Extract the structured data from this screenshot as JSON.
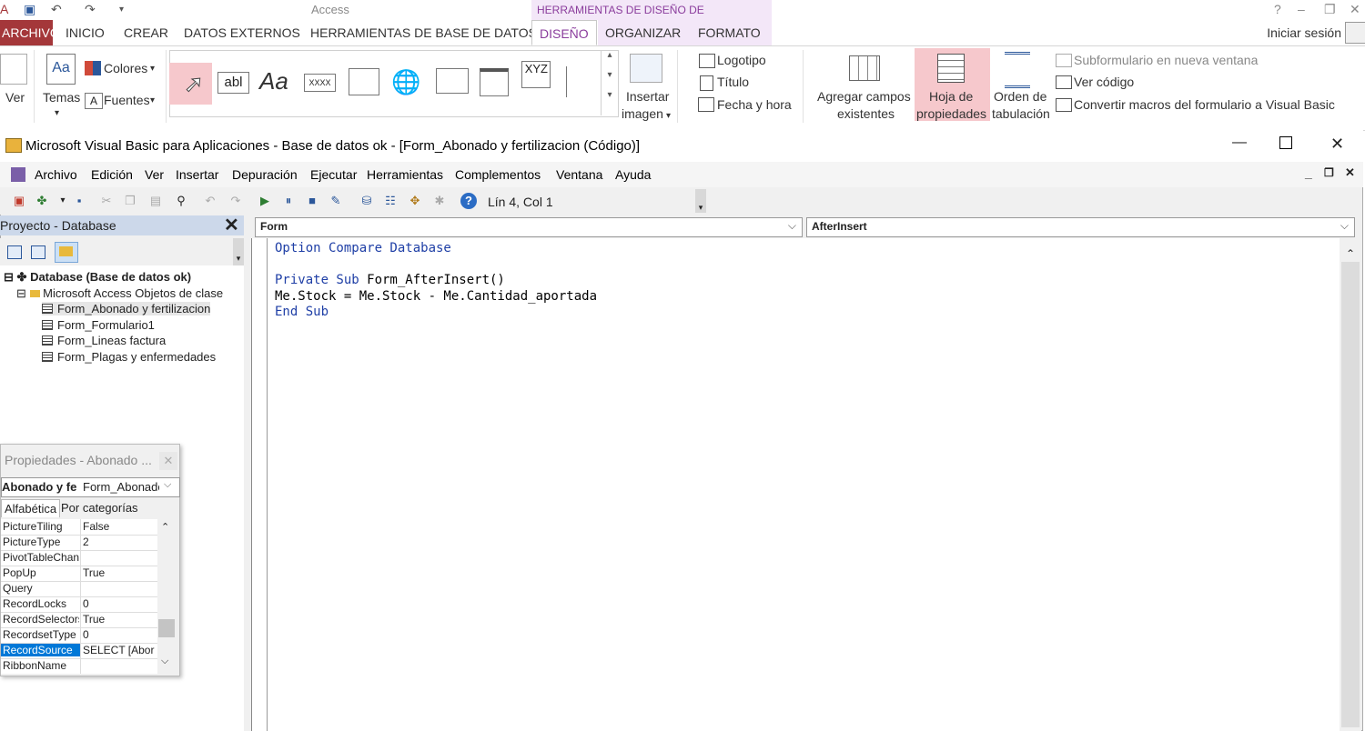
{
  "access": {
    "title": "Access",
    "contextual_label": "HERRAMIENTAS DE DISEÑO DE FORMULARIO",
    "tabs": [
      "ARCHIVO",
      "INICIO",
      "CREAR",
      "DATOS EXTERNOS",
      "HERRAMIENTAS DE BASE DE DATOS",
      "DISEÑO",
      "ORGANIZAR",
      "FORMATO"
    ],
    "signin": "Iniciar sesión",
    "help": "?"
  },
  "ribbon": {
    "ver": "Ver",
    "temas": "Temas",
    "colores": "Colores",
    "fuentes": "Fuentes",
    "fuentes_icon": "A",
    "temas_icon": "Aa",
    "text_box_icon": "abl",
    "label_icon": "Aa",
    "button_icon": "XXXX",
    "xyz_icon": "XYZ",
    "insertar_imagen_1": "Insertar",
    "insertar_imagen_2": "imagen",
    "logotipo": "Logotipo",
    "titulo": "Título",
    "fecha_hora": "Fecha y hora",
    "agregar_campos_1": "Agregar campos",
    "agregar_campos_2": "existentes",
    "hoja_prop_1": "Hoja de",
    "hoja_prop_2": "propiedades",
    "orden_tab_1": "Orden de",
    "orden_tab_2": "tabulación",
    "subformulario": "Subformulario en nueva ventana",
    "ver_codigo": "Ver código",
    "convertir": "Convertir macros del formulario a Visual Basic"
  },
  "vba": {
    "title": "Microsoft Visual Basic para Aplicaciones - Base de datos ok - [Form_Abonado y fertilizacion (Código)]",
    "menus": [
      "Archivo",
      "Edición",
      "Ver",
      "Insertar",
      "Depuración",
      "Ejecutar",
      "Herramientas",
      "Complementos",
      "Ventana",
      "Ayuda"
    ],
    "line_col": "Lín 4, Col 1",
    "project": {
      "header": "Proyecto - Database",
      "root": "Database (Base de datos ok)",
      "folder": "Microsoft Access Objetos de clase",
      "items": [
        "Form_Abonado y fertilizacion",
        "Form_Formulario1",
        "Form_Lineas factura",
        "Form_Plagas y enfermedades"
      ]
    },
    "properties": {
      "title": "Propiedades - Abonado ...",
      "combo_left": "Abonado y fe",
      "combo_right": "Form_Abonado",
      "tab_alpha": "Alfabética",
      "tab_cat": "Por categorías",
      "rows": [
        {
          "name": "PictureTiling",
          "value": "False"
        },
        {
          "name": "PictureType",
          "value": "2"
        },
        {
          "name": "PivotTableChan",
          "value": ""
        },
        {
          "name": "PopUp",
          "value": "True"
        },
        {
          "name": "Query",
          "value": ""
        },
        {
          "name": "RecordLocks",
          "value": "0"
        },
        {
          "name": "RecordSelectors",
          "value": "True"
        },
        {
          "name": "RecordsetType",
          "value": "0"
        },
        {
          "name": "RecordSource",
          "value": "SELECT [Abor"
        },
        {
          "name": "RibbonName",
          "value": ""
        }
      ]
    },
    "code": {
      "object_combo": "Form",
      "proc_combo": "AfterInsert",
      "line1_kw": "Option Compare Database",
      "line3_kw1": "Private Sub",
      "line3_rest": " Form_AfterInsert()",
      "line4": "Me.Stock = Me.Stock - Me.Cantidad_aportada",
      "line5_kw": "End Sub"
    }
  }
}
